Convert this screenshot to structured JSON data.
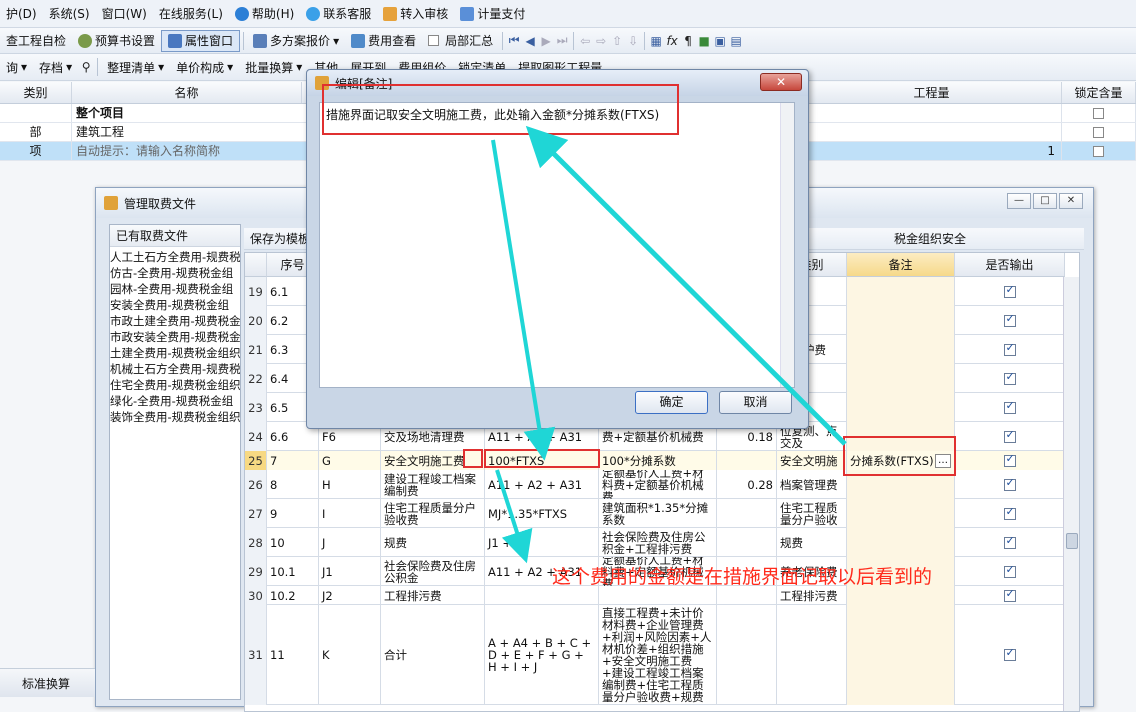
{
  "menubar": {
    "items": [
      "护(D)",
      "系统(S)",
      "窗口(W)",
      "在线服务(L)",
      "帮助(H)",
      "联系客服",
      "转入审核",
      "计量支付"
    ]
  },
  "toolbar1": {
    "items": [
      "查工程自检",
      "预算书设置",
      "属性窗口",
      "多方案报价",
      "费用查看",
      "局部汇总"
    ]
  },
  "toolbar2": {
    "items": [
      "询",
      "存档",
      "整理清单",
      "单价构成",
      "批量换算",
      "其他",
      "展开到",
      "费用组价",
      "锁定清单",
      "提取图形工程量"
    ]
  },
  "main_table": {
    "headers": {
      "type": "类别",
      "name": "名称",
      "qty": "工程量",
      "lock": "锁定含量"
    },
    "rows": [
      {
        "type": "",
        "name": "整个项目",
        "qty": ""
      },
      {
        "type": "部",
        "name": "建筑工程",
        "qty": ""
      },
      {
        "type": "项",
        "name": "自动提示：请输入名称简称",
        "qty": "1"
      }
    ]
  },
  "manage_dialog": {
    "title": "管理取费文件",
    "left_header": "已有取费文件",
    "files": [
      "人工土石方全费用-规费税",
      "仿古-全费用-规费税金组",
      "园林-全费用-规费税金组",
      "安装全费用-规费税金组",
      "市政土建全费用-规费税金",
      "市政安装全费用-规费税金",
      "土建全费用-规费税金组织",
      "机械土石方全费用-规费税",
      "住宅全费用-规费税金组织",
      "绿化-全费用-规费税金组",
      "装饰全费用-规费税金组织"
    ],
    "toolbar_save": "保存为模板",
    "toolbar_tail": "税金组织安全",
    "col_headers": {
      "seq": "序号",
      "category": "类别",
      "note": "备注",
      "output": "是否输出"
    },
    "rows": [
      {
        "n": "19",
        "seq": "6.1",
        "code": "",
        "name": "",
        "base": "",
        "desc": "",
        "rate": "",
        "cat": "工费",
        "note": ""
      },
      {
        "n": "20",
        "seq": "6.2",
        "code": "",
        "name": "",
        "base": "",
        "desc": "",
        "rate": "",
        "cat": "施工",
        "note": ""
      },
      {
        "n": "21",
        "seq": "6.3",
        "code": "",
        "name": "",
        "base": "",
        "desc": "",
        "rate": "",
        "cat": "程及护费",
        "note": ""
      },
      {
        "n": "22",
        "seq": "6.4",
        "code": "",
        "name": "",
        "base": "",
        "desc": "",
        "rate": "",
        "cat": "验试",
        "note": ""
      },
      {
        "n": "23",
        "seq": "6.5",
        "code": "",
        "name": "",
        "base": "",
        "desc": "",
        "rate": "",
        "cat": "运费",
        "note": ""
      },
      {
        "n": "24",
        "seq": "6.6",
        "code": "F6",
        "name": "交及场地清理费",
        "base": "A11 + A2 + A31",
        "desc": "费+定额基价机械费",
        "rate": "0.18",
        "cat": "位复测、点交及",
        "note": ""
      },
      {
        "n": "25",
        "seq": "7",
        "code": "G",
        "name": "安全文明施工费",
        "base": "100*FTXS",
        "desc": "100*分摊系数",
        "rate": "",
        "cat": "安全文明施",
        "note": "分摊系数(FTXS)"
      },
      {
        "n": "26",
        "seq": "8",
        "code": "H",
        "name": "建设工程竣工档案编制费",
        "base": "A11 + A2 + A31",
        "desc": "定额基价人工费+材料费+定额基价机械费",
        "rate": "0.28",
        "cat": "档案管理费",
        "note": ""
      },
      {
        "n": "27",
        "seq": "9",
        "code": "I",
        "name": "住宅工程质量分户验收费",
        "base": "MJ*1.35*FTXS",
        "desc": "建筑面积*1.35*分摊系数",
        "rate": "",
        "cat": "住宅工程质量分户验收",
        "note": ""
      },
      {
        "n": "28",
        "seq": "10",
        "code": "J",
        "name": "规费",
        "base": "J1 + J2",
        "desc": "社会保险费及住房公积金+工程排污费",
        "rate": "",
        "cat": "规费",
        "note": ""
      },
      {
        "n": "29",
        "seq": "10.1",
        "code": "J1",
        "name": "社会保险费及住房公积金",
        "base": "A11 + A2 + A31",
        "desc": "定额基价人工费+材料费+定额基价机械费",
        "rate": "",
        "cat": "养老保险费",
        "note": ""
      },
      {
        "n": "30",
        "seq": "10.2",
        "code": "J2",
        "name": "工程排污费",
        "base": "",
        "desc": "",
        "rate": "",
        "cat": "工程排污费",
        "note": ""
      },
      {
        "n": "31",
        "seq": "11",
        "code": "K",
        "name": "合计",
        "base": "A + A4 + B + C + D + E + F + G + H + I + J",
        "desc": "直接工程费+未计价材料费+企业管理费+利润+风险因素+人材机价差+组织措施+安全文明施工费+建设工程竣工档案编制费+住宅工程质量分户验收费+规费",
        "rate": "",
        "cat": "",
        "note": ""
      }
    ]
  },
  "edit_dialog": {
    "title": "编辑[备注]",
    "text": "措施界面记取安全文明施工费，此处输入金额*分摊系数(FTXS)",
    "ok": "确定",
    "cancel": "取消"
  },
  "annotation": "这个费用的金额是在措施界面记取以后看到的",
  "statusbar": {
    "label": "标准换算"
  },
  "colors": {
    "accent": "#bfe0f8",
    "annotation": "#ff2b1c",
    "arrow": "#1fd6d6",
    "redbox": "#e03030"
  }
}
